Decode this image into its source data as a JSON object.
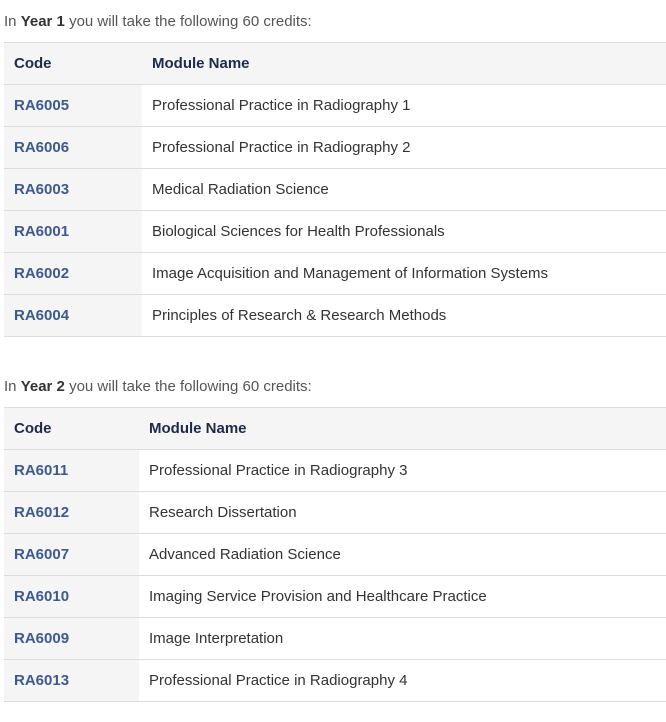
{
  "colors": {
    "code_text": "#3d5a8f",
    "header_text": "#1e2a4a",
    "shaded_bg": "#f5f5f5",
    "border": "#dddddd"
  },
  "years": [
    {
      "intro_prefix": "In",
      "year_label": "Year 1",
      "intro_suffix": "you will take the following 60 credits:",
      "headers": {
        "code": "Code",
        "name": "Module Name"
      },
      "modules": [
        {
          "code": "RA6005",
          "name": "Professional Practice in Radiography 1"
        },
        {
          "code": "RA6006",
          "name": "Professional Practice in Radiography 2"
        },
        {
          "code": "RA6003",
          "name": "Medical Radiation Science"
        },
        {
          "code": "RA6001",
          "name": "Biological Sciences for Health Professionals"
        },
        {
          "code": "RA6002",
          "name": "Image Acquisition and Management of Information Systems"
        },
        {
          "code": "RA6004",
          "name": "Principles of Research & Research Methods"
        }
      ]
    },
    {
      "intro_prefix": "In",
      "year_label": "Year 2",
      "intro_suffix": "you will take the following 60 credits:",
      "headers": {
        "code": "Code",
        "name": "Module Name"
      },
      "modules": [
        {
          "code": "RA6011",
          "name": "Professional Practice in Radiography 3"
        },
        {
          "code": "RA6012",
          "name": "Research Dissertation"
        },
        {
          "code": "RA6007",
          "name": "Advanced Radiation Science"
        },
        {
          "code": "RA6010",
          "name": "Imaging Service Provision and Healthcare Practice"
        },
        {
          "code": "RA6009",
          "name": "Image Interpretation"
        },
        {
          "code": "RA6013",
          "name": "Professional Practice in Radiography 4"
        }
      ]
    }
  ]
}
